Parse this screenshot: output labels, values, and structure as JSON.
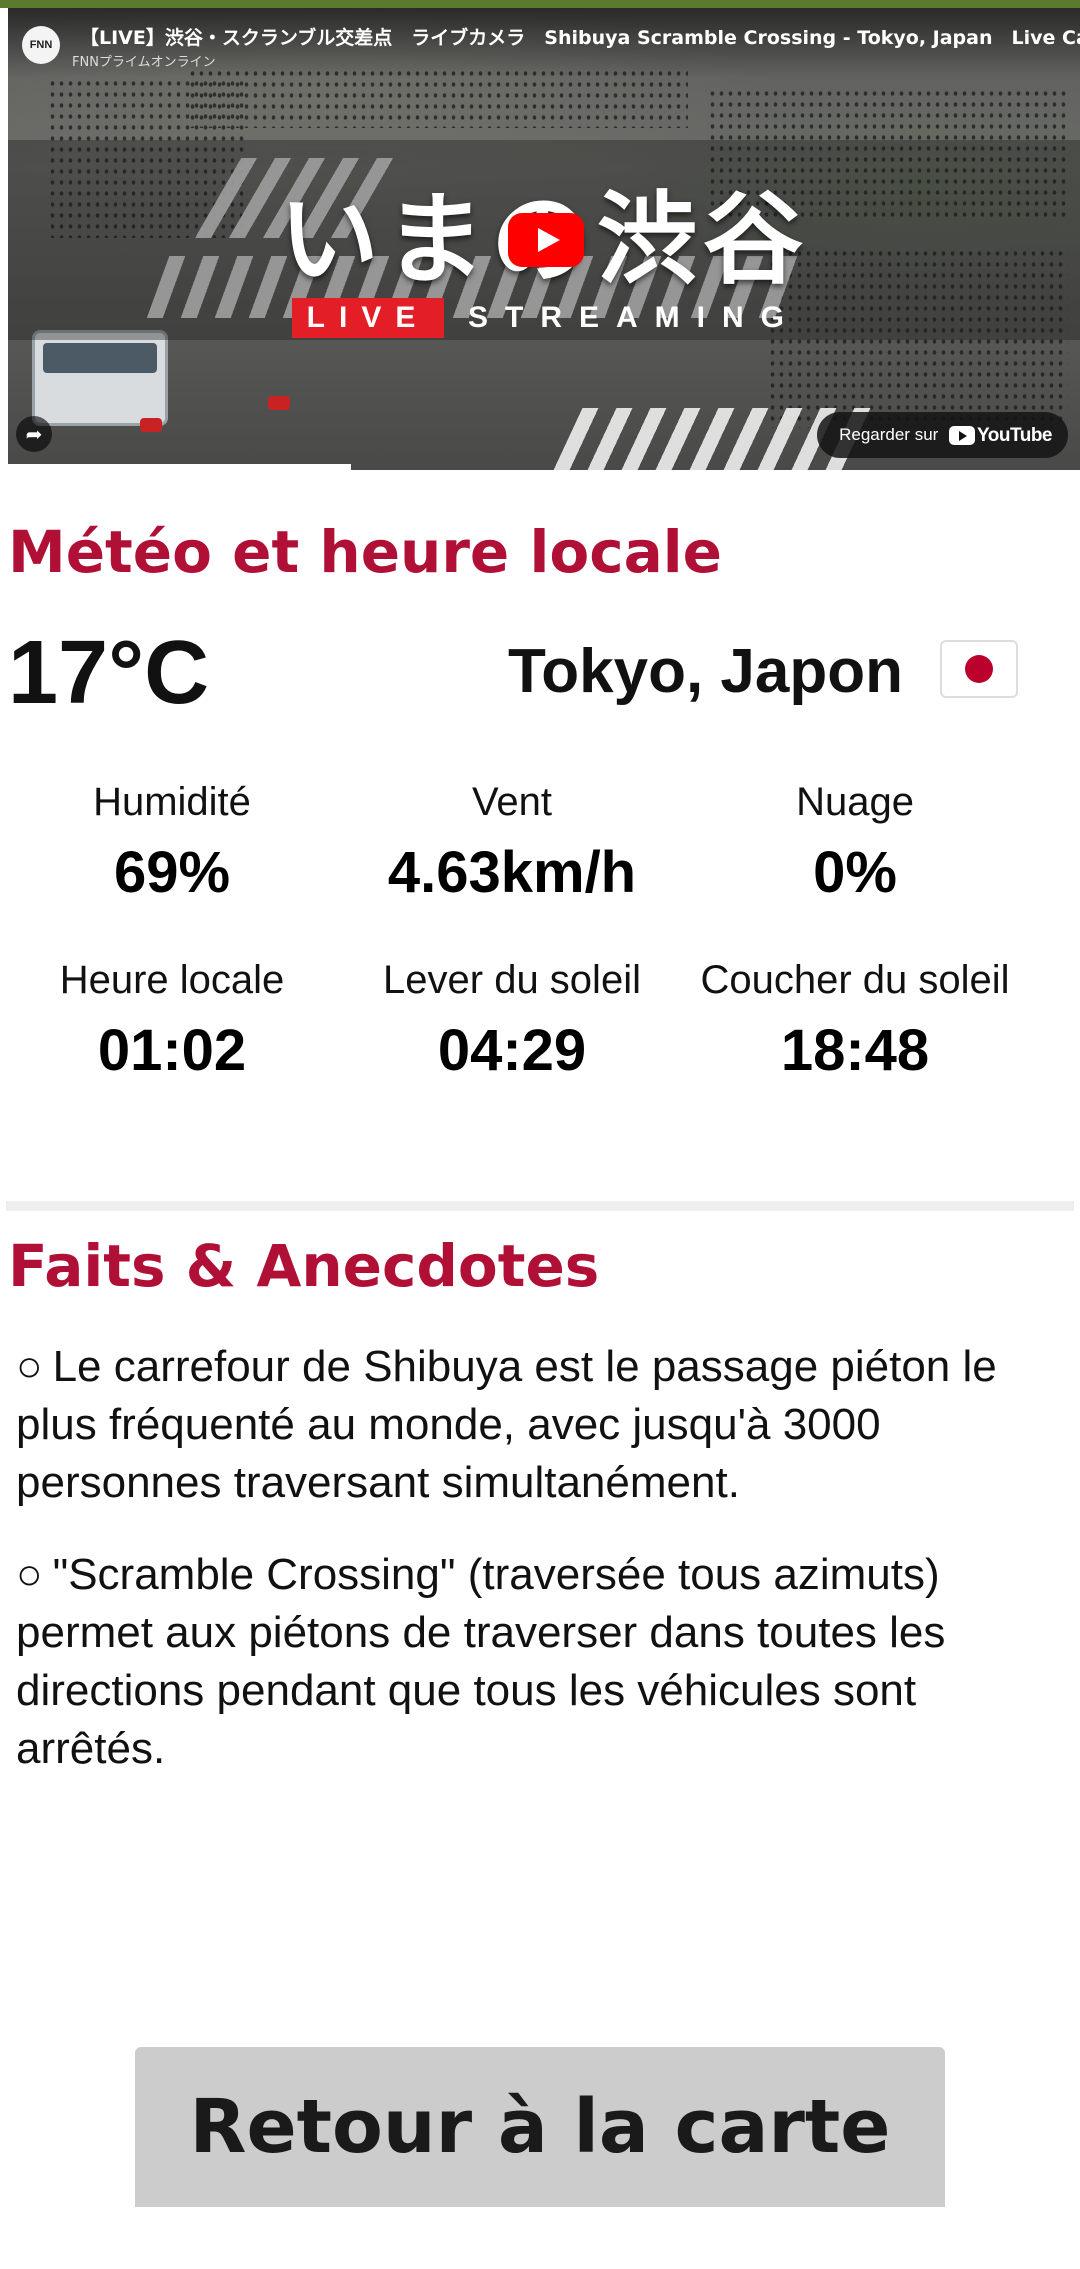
{
  "video": {
    "channel_logo": "FNN",
    "title": "【LIVE】渋谷・スクランブル交差点　ライブカメラ　Shibuya Scramble Crossing - Tokyo, Japan　Live Cam",
    "channel": "FNNプライムオンライン",
    "banner_title": "いまの渋谷",
    "live_label": "LIVE",
    "streaming_label": "STREAMING",
    "watch_on": "Regarder sur",
    "watch_brand": "YouTube",
    "progress": 0.32
  },
  "weather": {
    "heading": "Météo et heure locale",
    "temperature": "17°C",
    "location": "Tokyo, Japon",
    "flag_icon": "japan-flag-icon",
    "stats": [
      {
        "label": "Humidité",
        "value": "69%"
      },
      {
        "label": "Vent",
        "value": "4.63km/h"
      },
      {
        "label": "Nuage",
        "value": "0%"
      },
      {
        "label": "Heure locale",
        "value": "01:02"
      },
      {
        "label": "Lever du soleil",
        "value": "04:29"
      },
      {
        "label": "Coucher du soleil",
        "value": "18:48"
      }
    ]
  },
  "facts": {
    "heading": "Faits & Anecdotes",
    "bullet": "○",
    "items": [
      "Le carrefour de Shibuya est le passage piéton le plus fréquenté au monde, avec jusqu'à 3000 personnes traversant simultanément.",
      "\"Scramble Crossing\" (traversée tous azimuts) permet aux piétons de traverser dans toutes les directions pendant que tous les véhicules sont arrêtés."
    ]
  },
  "back_button": "Retour à la carte",
  "colors": {
    "heading": "#b01036",
    "button_bg": "#cccccc",
    "live_red": "#e41e26"
  }
}
